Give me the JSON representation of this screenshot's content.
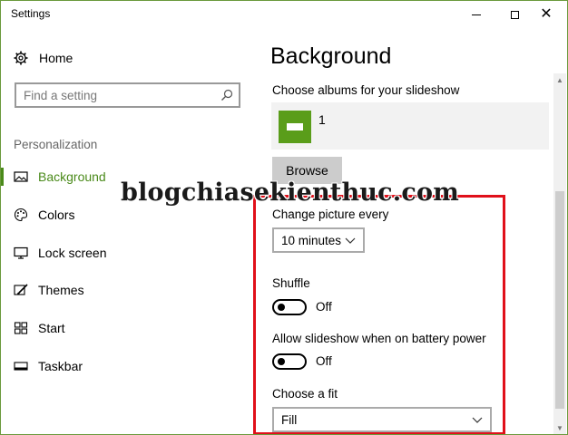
{
  "window": {
    "title": "Settings"
  },
  "sidebar": {
    "home_label": "Home",
    "search_placeholder": "Find a setting",
    "section_label": "Personalization",
    "items": [
      {
        "label": "Background",
        "icon": "image-icon",
        "active": true
      },
      {
        "label": "Colors",
        "icon": "palette-icon"
      },
      {
        "label": "Lock screen",
        "icon": "monitor-icon"
      },
      {
        "label": "Themes",
        "icon": "brush-icon"
      },
      {
        "label": "Start",
        "icon": "start-grid-icon"
      },
      {
        "label": "Taskbar",
        "icon": "taskbar-icon"
      }
    ]
  },
  "main": {
    "title": "Background",
    "albums_label": "Choose albums for your slideshow",
    "album_name": "1",
    "browse_label": "Browse",
    "change_picture_label": "Change picture every",
    "change_picture_value": "10 minutes",
    "shuffle_label": "Shuffle",
    "shuffle_state": "Off",
    "battery_label": "Allow slideshow when on battery power",
    "battery_state": "Off",
    "fit_label": "Choose a fit",
    "fit_value": "Fill"
  },
  "watermark": "blogchiasekienthuc.com",
  "colors": {
    "accent": "#4a8a1a",
    "highlight_box": "#e0101a",
    "album_thumb": "#5a9d1a"
  }
}
